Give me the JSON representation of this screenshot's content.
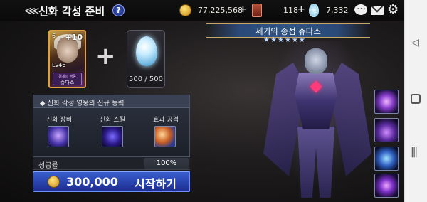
{
  "header": {
    "back_glyph": "⋘",
    "title": "신화 각성 준비",
    "help_glyph": "?"
  },
  "currencies": {
    "gold": "77,225,568",
    "tickets": "118",
    "gems": "7,332",
    "plus_glyph": "+"
  },
  "material": {
    "hero_plus": "+10",
    "hero_level": "Lv46",
    "hero_rank": "6",
    "hero_subtitle": "경계의 쌍둥",
    "hero_name": "쥬다스",
    "crystal_count": "500 / 500",
    "combine_glyph": "+"
  },
  "abilities": {
    "header": "신화 각성 영웅의 신규 능력",
    "items": [
      {
        "label": "신화 장비"
      },
      {
        "label": "신화 스킬"
      },
      {
        "label": "효과 공격"
      }
    ]
  },
  "success": {
    "label": "성공률",
    "value": "100%"
  },
  "start_button": {
    "cost": "300,000",
    "label": "시작하기"
  },
  "preview": {
    "title": "세기의 종접 쥬다스",
    "stars": "★★★★★★"
  },
  "navbar": {
    "back_glyph": "◁",
    "recent_glyph": "|||"
  },
  "colors": {
    "accent_blue": "#2a45b8",
    "gold": "#e1a03b",
    "panel": "#2c323f"
  }
}
